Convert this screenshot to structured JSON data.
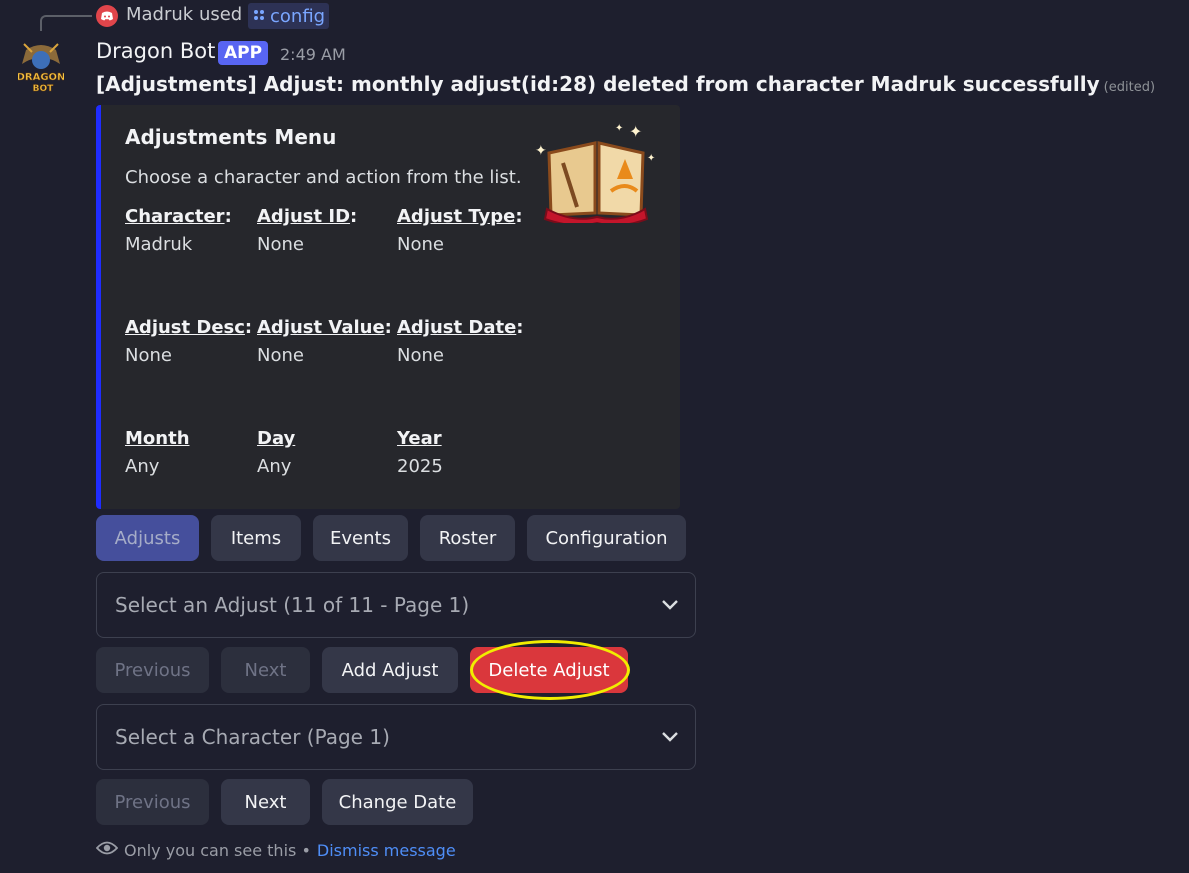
{
  "reply": {
    "user_text": "Madruk used",
    "command": "config"
  },
  "message": {
    "author": "Dragon Bot",
    "badge": "APP",
    "time": "2:49 AM",
    "text": "[Adjustments] Adjust: monthly adjust(id:28) deleted from character Madruk successfully",
    "edited": "(edited)",
    "avatar_text": [
      "DRAGON",
      "BOT"
    ]
  },
  "embed": {
    "title": "Adjustments Menu",
    "description": "Choose a character and action from the list.",
    "accent_color": "#1f2cff",
    "fields": [
      {
        "name": "Character",
        "suffix": ":",
        "value": "Madruk"
      },
      {
        "name": "Adjust ID",
        "suffix": ":",
        "value": "None"
      },
      {
        "name": "Adjust Type",
        "suffix": ":",
        "value": "None"
      },
      {
        "name": "Adjust Desc",
        "suffix": ":",
        "value": "None"
      },
      {
        "name": "Adjust Value",
        "suffix": ":",
        "value": "None"
      },
      {
        "name": "Adjust Date",
        "suffix": ":",
        "value": "None"
      },
      {
        "name": "Month",
        "suffix": "",
        "value": "Any"
      },
      {
        "name": "Day",
        "suffix": "",
        "value": "Any"
      },
      {
        "name": "Year",
        "suffix": "",
        "value": "2025"
      }
    ]
  },
  "tabs": [
    "Adjusts",
    "Items",
    "Events",
    "Roster",
    "Configuration"
  ],
  "select_adjust": {
    "placeholder": "Select an Adjust (11 of 11 - Page 1)"
  },
  "adjust_buttons": {
    "previous": "Previous",
    "next": "Next",
    "add": "Add Adjust",
    "delete": "Delete Adjust"
  },
  "select_character": {
    "placeholder": "Select a Character (Page 1)"
  },
  "character_buttons": {
    "previous": "Previous",
    "next": "Next",
    "change_date": "Change Date"
  },
  "footer": {
    "text": "Only you can see this •",
    "link": "Dismiss message"
  },
  "colors": {
    "background": "#1e1f2e",
    "danger": "#da373c",
    "brand": "#5865f2",
    "highlight": "#f1ed00"
  }
}
